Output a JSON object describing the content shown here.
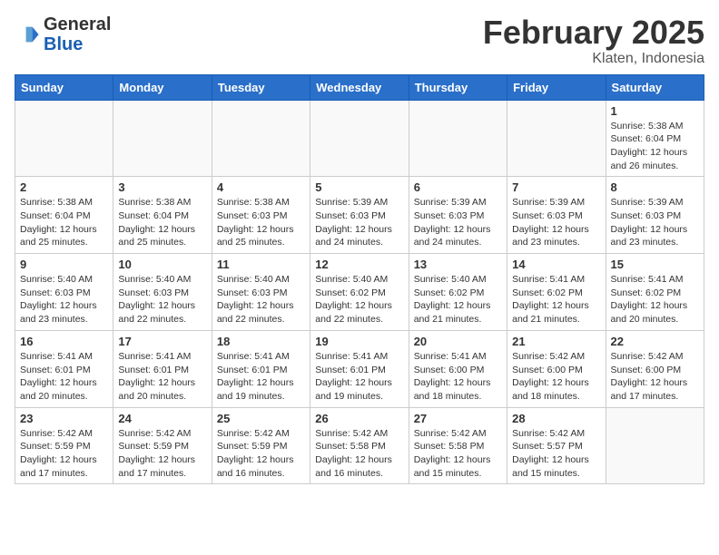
{
  "logo": {
    "general": "General",
    "blue": "Blue"
  },
  "header": {
    "month": "February 2025",
    "location": "Klaten, Indonesia"
  },
  "weekdays": [
    "Sunday",
    "Monday",
    "Tuesday",
    "Wednesday",
    "Thursday",
    "Friday",
    "Saturday"
  ],
  "weeks": [
    [
      {
        "day": "",
        "info": ""
      },
      {
        "day": "",
        "info": ""
      },
      {
        "day": "",
        "info": ""
      },
      {
        "day": "",
        "info": ""
      },
      {
        "day": "",
        "info": ""
      },
      {
        "day": "",
        "info": ""
      },
      {
        "day": "1",
        "info": "Sunrise: 5:38 AM\nSunset: 6:04 PM\nDaylight: 12 hours\nand 26 minutes."
      }
    ],
    [
      {
        "day": "2",
        "info": "Sunrise: 5:38 AM\nSunset: 6:04 PM\nDaylight: 12 hours\nand 25 minutes."
      },
      {
        "day": "3",
        "info": "Sunrise: 5:38 AM\nSunset: 6:04 PM\nDaylight: 12 hours\nand 25 minutes."
      },
      {
        "day": "4",
        "info": "Sunrise: 5:38 AM\nSunset: 6:03 PM\nDaylight: 12 hours\nand 25 minutes."
      },
      {
        "day": "5",
        "info": "Sunrise: 5:39 AM\nSunset: 6:03 PM\nDaylight: 12 hours\nand 24 minutes."
      },
      {
        "day": "6",
        "info": "Sunrise: 5:39 AM\nSunset: 6:03 PM\nDaylight: 12 hours\nand 24 minutes."
      },
      {
        "day": "7",
        "info": "Sunrise: 5:39 AM\nSunset: 6:03 PM\nDaylight: 12 hours\nand 23 minutes."
      },
      {
        "day": "8",
        "info": "Sunrise: 5:39 AM\nSunset: 6:03 PM\nDaylight: 12 hours\nand 23 minutes."
      }
    ],
    [
      {
        "day": "9",
        "info": "Sunrise: 5:40 AM\nSunset: 6:03 PM\nDaylight: 12 hours\nand 23 minutes."
      },
      {
        "day": "10",
        "info": "Sunrise: 5:40 AM\nSunset: 6:03 PM\nDaylight: 12 hours\nand 22 minutes."
      },
      {
        "day": "11",
        "info": "Sunrise: 5:40 AM\nSunset: 6:03 PM\nDaylight: 12 hours\nand 22 minutes."
      },
      {
        "day": "12",
        "info": "Sunrise: 5:40 AM\nSunset: 6:02 PM\nDaylight: 12 hours\nand 22 minutes."
      },
      {
        "day": "13",
        "info": "Sunrise: 5:40 AM\nSunset: 6:02 PM\nDaylight: 12 hours\nand 21 minutes."
      },
      {
        "day": "14",
        "info": "Sunrise: 5:41 AM\nSunset: 6:02 PM\nDaylight: 12 hours\nand 21 minutes."
      },
      {
        "day": "15",
        "info": "Sunrise: 5:41 AM\nSunset: 6:02 PM\nDaylight: 12 hours\nand 20 minutes."
      }
    ],
    [
      {
        "day": "16",
        "info": "Sunrise: 5:41 AM\nSunset: 6:01 PM\nDaylight: 12 hours\nand 20 minutes."
      },
      {
        "day": "17",
        "info": "Sunrise: 5:41 AM\nSunset: 6:01 PM\nDaylight: 12 hours\nand 20 minutes."
      },
      {
        "day": "18",
        "info": "Sunrise: 5:41 AM\nSunset: 6:01 PM\nDaylight: 12 hours\nand 19 minutes."
      },
      {
        "day": "19",
        "info": "Sunrise: 5:41 AM\nSunset: 6:01 PM\nDaylight: 12 hours\nand 19 minutes."
      },
      {
        "day": "20",
        "info": "Sunrise: 5:41 AM\nSunset: 6:00 PM\nDaylight: 12 hours\nand 18 minutes."
      },
      {
        "day": "21",
        "info": "Sunrise: 5:42 AM\nSunset: 6:00 PM\nDaylight: 12 hours\nand 18 minutes."
      },
      {
        "day": "22",
        "info": "Sunrise: 5:42 AM\nSunset: 6:00 PM\nDaylight: 12 hours\nand 17 minutes."
      }
    ],
    [
      {
        "day": "23",
        "info": "Sunrise: 5:42 AM\nSunset: 5:59 PM\nDaylight: 12 hours\nand 17 minutes."
      },
      {
        "day": "24",
        "info": "Sunrise: 5:42 AM\nSunset: 5:59 PM\nDaylight: 12 hours\nand 17 minutes."
      },
      {
        "day": "25",
        "info": "Sunrise: 5:42 AM\nSunset: 5:59 PM\nDaylight: 12 hours\nand 16 minutes."
      },
      {
        "day": "26",
        "info": "Sunrise: 5:42 AM\nSunset: 5:58 PM\nDaylight: 12 hours\nand 16 minutes."
      },
      {
        "day": "27",
        "info": "Sunrise: 5:42 AM\nSunset: 5:58 PM\nDaylight: 12 hours\nand 15 minutes."
      },
      {
        "day": "28",
        "info": "Sunrise: 5:42 AM\nSunset: 5:57 PM\nDaylight: 12 hours\nand 15 minutes."
      },
      {
        "day": "",
        "info": ""
      }
    ]
  ]
}
